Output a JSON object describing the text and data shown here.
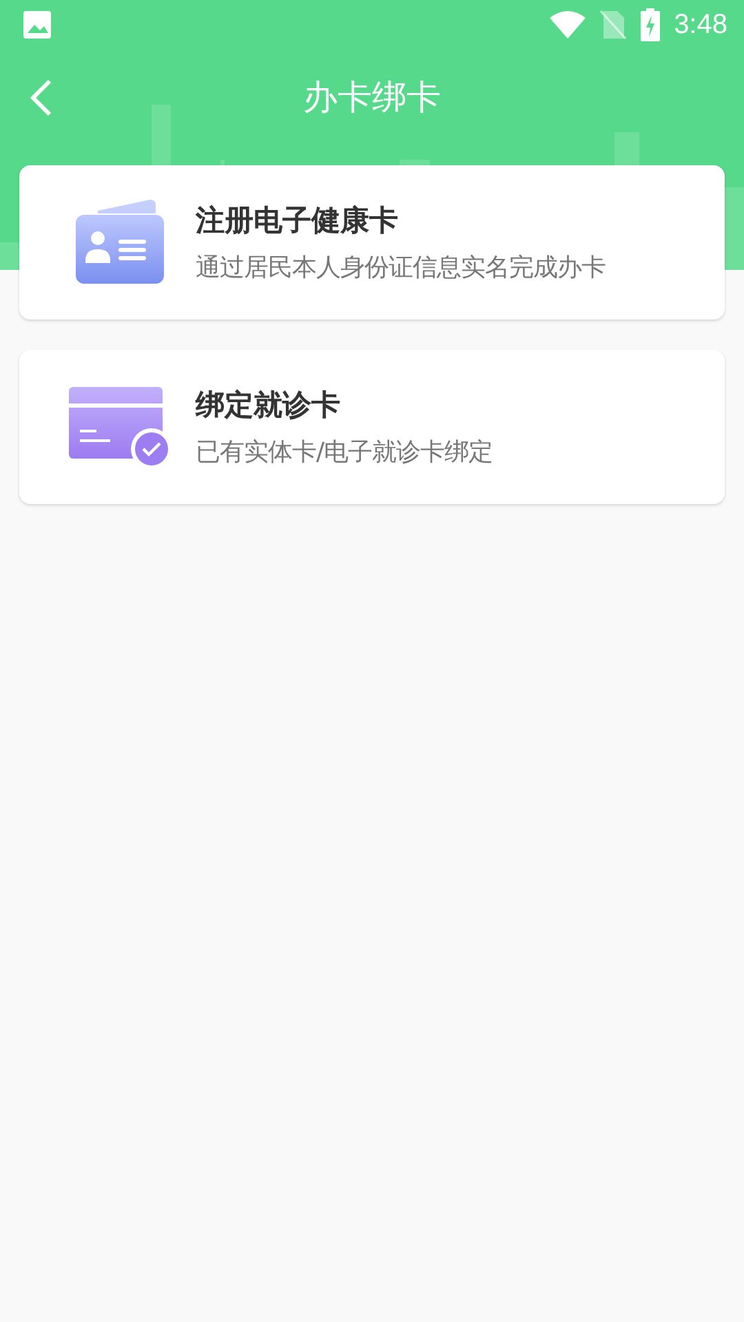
{
  "status_bar": {
    "time": "3:48"
  },
  "header": {
    "title": "办卡绑卡"
  },
  "options": [
    {
      "kind": "register",
      "title": "注册电子健康卡",
      "subtitle": "通过居民本人身份证信息实名完成办卡"
    },
    {
      "kind": "bind",
      "title": "绑定就诊卡",
      "subtitle": "已有实体卡/电子就诊卡绑定"
    }
  ]
}
